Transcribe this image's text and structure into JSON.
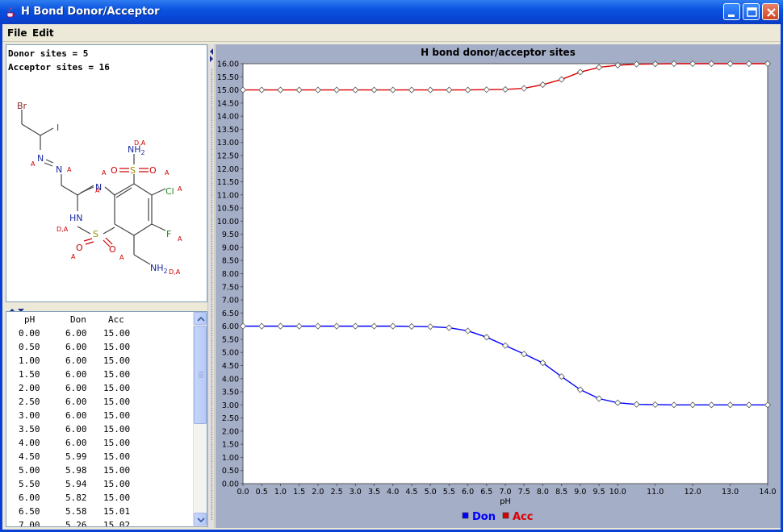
{
  "window": {
    "title": "H Bond Donor/Acceptor",
    "controls": [
      "minimize-icon",
      "maximize-icon",
      "close-icon"
    ]
  },
  "menu": {
    "file": "File",
    "edit": "Edit"
  },
  "summary": {
    "donor": "Donor sites = 5",
    "acceptor": "Acceptor sites = 16"
  },
  "molecule": {
    "labels": {
      "br": "Br",
      "i": "I",
      "n1": "N",
      "n2": "N",
      "n3": "N",
      "nh": "HN",
      "s1": "S",
      "o1": "O",
      "o2": "O",
      "s2": "S",
      "o3": "O",
      "o4": "O",
      "nh2a": "NH2",
      "cl": "Cl",
      "f": "F",
      "nh2b": "NH2",
      "da1": "D,A",
      "da2": "D,A",
      "da3": "D,A",
      "a": "A"
    }
  },
  "table": {
    "headers": [
      "pH",
      "Don",
      "Acc"
    ],
    "rows": [
      [
        "0.00",
        "6.00",
        "15.00"
      ],
      [
        "0.50",
        "6.00",
        "15.00"
      ],
      [
        "1.00",
        "6.00",
        "15.00"
      ],
      [
        "1.50",
        "6.00",
        "15.00"
      ],
      [
        "2.00",
        "6.00",
        "15.00"
      ],
      [
        "2.50",
        "6.00",
        "15.00"
      ],
      [
        "3.00",
        "6.00",
        "15.00"
      ],
      [
        "3.50",
        "6.00",
        "15.00"
      ],
      [
        "4.00",
        "6.00",
        "15.00"
      ],
      [
        "4.50",
        "5.99",
        "15.00"
      ],
      [
        "5.00",
        "5.98",
        "15.00"
      ],
      [
        "5.50",
        "5.94",
        "15.00"
      ],
      [
        "6.00",
        "5.82",
        "15.00"
      ],
      [
        "6.50",
        "5.58",
        "15.01"
      ],
      [
        "7.00",
        "5.26",
        "15.02"
      ]
    ]
  },
  "chart_data": {
    "type": "line",
    "title": "H bond donor/acceptor sites",
    "xlabel": "pH",
    "ylabel": "",
    "xlim": [
      0,
      14
    ],
    "ylim": [
      0,
      16
    ],
    "x_ticks": [
      "0.0",
      "0.5",
      "1.0",
      "1.5",
      "2.0",
      "2.5",
      "3.0",
      "3.5",
      "4.0",
      "4.5",
      "5.0",
      "5.5",
      "6.0",
      "6.5",
      "7.0",
      "7.5",
      "8.0",
      "8.5",
      "9.0",
      "9.5",
      "10.0",
      "11.0",
      "12.0",
      "13.0",
      "14.0"
    ],
    "y_ticks": [
      "0.00",
      "0.50",
      "1.00",
      "1.50",
      "2.00",
      "2.50",
      "3.00",
      "3.50",
      "4.00",
      "4.50",
      "5.00",
      "5.50",
      "6.00",
      "6.50",
      "7.00",
      "7.50",
      "8.00",
      "8.50",
      "9.00",
      "9.50",
      "10.00",
      "10.50",
      "11.00",
      "11.50",
      "12.00",
      "12.50",
      "13.00",
      "13.50",
      "14.00",
      "14.50",
      "15.00",
      "15.50",
      "16.00"
    ],
    "grid": false,
    "legend": "bottom",
    "x": [
      0,
      0.5,
      1,
      1.5,
      2,
      2.5,
      3,
      3.5,
      4,
      4.5,
      5,
      5.5,
      6,
      6.5,
      7,
      7.5,
      8,
      8.5,
      9,
      9.5,
      10,
      10.5,
      11,
      11.5,
      12,
      12.5,
      13,
      13.5,
      14
    ],
    "series": [
      {
        "name": "Don",
        "color": "#0000ff",
        "values": [
          6.0,
          6.0,
          6.0,
          6.0,
          6.0,
          6.0,
          6.0,
          6.0,
          6.0,
          5.99,
          5.98,
          5.94,
          5.82,
          5.58,
          5.26,
          4.94,
          4.6,
          4.08,
          3.58,
          3.24,
          3.08,
          3.02,
          3.01,
          3.0,
          3.0,
          3.0,
          3.0,
          3.0,
          3.0
        ]
      },
      {
        "name": "Acc",
        "color": "#dd0000",
        "values": [
          15.0,
          15.0,
          15.0,
          15.0,
          15.0,
          15.0,
          15.0,
          15.0,
          15.0,
          15.0,
          15.0,
          15.0,
          15.0,
          15.01,
          15.02,
          15.06,
          15.2,
          15.4,
          15.68,
          15.86,
          15.94,
          15.98,
          15.99,
          16.0,
          16.0,
          16.0,
          16.0,
          16.0,
          16.0
        ]
      }
    ]
  }
}
